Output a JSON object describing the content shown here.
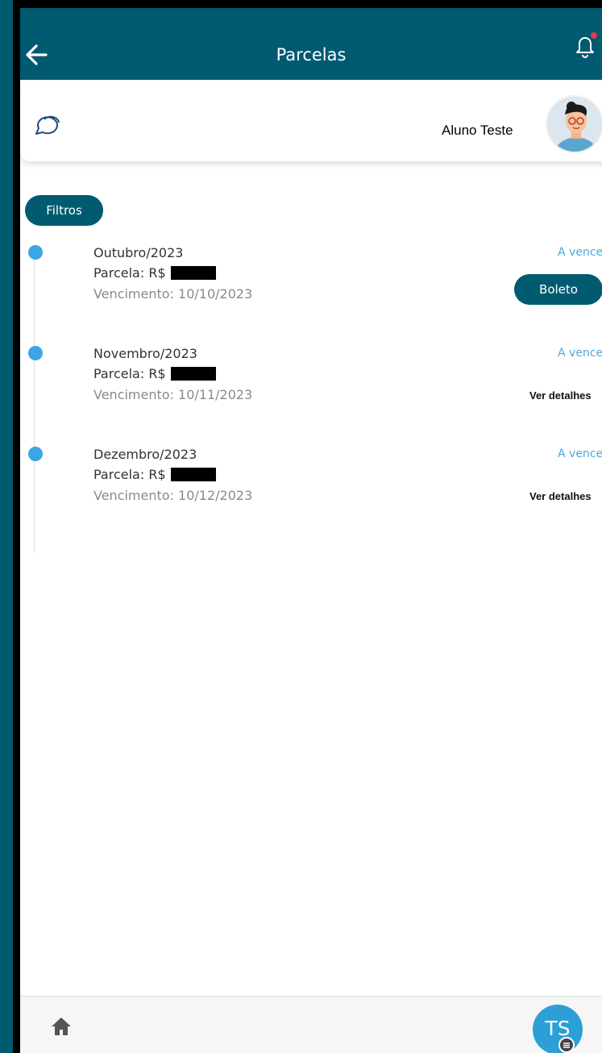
{
  "appbar": {
    "title": "Parcelas",
    "back_icon": "arrow-left-icon",
    "bell_icon": "bell-icon"
  },
  "profile": {
    "name": "Aluno Teste",
    "chat_icon": "chat-icon"
  },
  "filters": {
    "label": "Filtros"
  },
  "installments": [
    {
      "month": "Outubro/2023",
      "parcela_label": "Parcela: R$",
      "vencimento": "Vencimento: 10/10/2023",
      "status": "A vencer",
      "action": "Boleto"
    },
    {
      "month": "Novembro/2023",
      "parcela_label": "Parcela: R$",
      "vencimento": "Vencimento: 10/11/2023",
      "status": "A vencer",
      "action": "Ver detalhes"
    },
    {
      "month": "Dezembro/2023",
      "parcela_label": "Parcela: R$",
      "vencimento": "Vencimento: 10/12/2023",
      "status": "A vencer",
      "action": "Ver detalhes"
    }
  ],
  "bottom_nav": {
    "home_icon": "home-icon",
    "avatar_initials": "TS"
  },
  "colors": {
    "primary": "#005a70",
    "accent": "#3aa6e6",
    "status": "#4aa8df"
  }
}
